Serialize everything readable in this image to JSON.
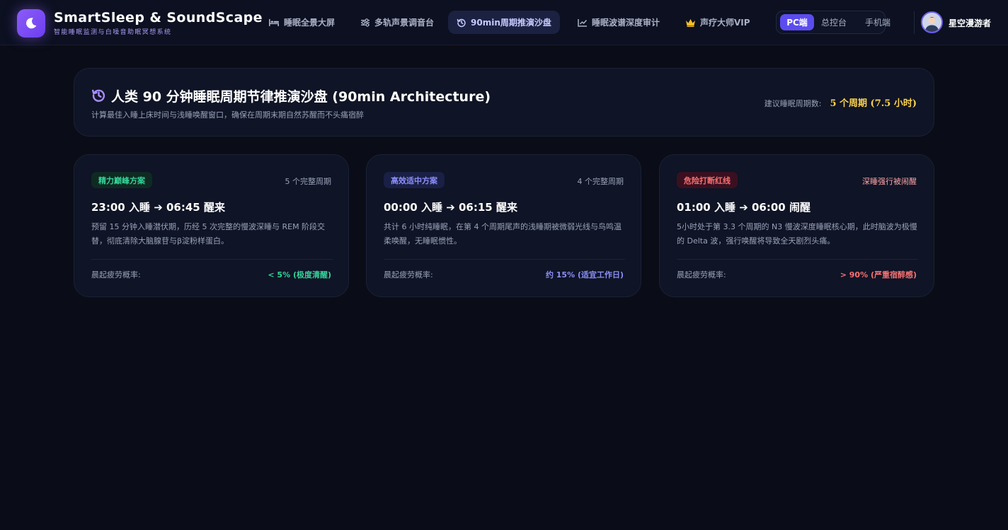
{
  "brand": {
    "title": "SmartSleep & SoundScape",
    "subtitle": "智能睡眠监测与白噪音助眠冥想系统",
    "logo_icon": "moon-icon",
    "accent": "#8b5cf6"
  },
  "nav": [
    {
      "label": "睡眠全景大屏",
      "icon": "bed-icon"
    },
    {
      "label": "多轨声景调音台",
      "icon": "sliders-icon"
    },
    {
      "label": "90min周期推演沙盘",
      "icon": "history-icon",
      "active": true
    },
    {
      "label": "睡眠波谱深度审计",
      "icon": "chart-line-icon"
    },
    {
      "label": "声疗大师VIP",
      "icon": "crown-icon"
    }
  ],
  "view_switch": {
    "options": [
      "PC端",
      "总控台",
      "手机端"
    ],
    "selected": "PC端"
  },
  "user": {
    "name": "星空漫游者",
    "avatar_icon": "avatar"
  },
  "hero": {
    "title": "人类 90 分钟睡眠周期节律推演沙盘 (90min Architecture)",
    "subtitle": "计算最佳入睡上床时间与浅睡唤醒窗口，确保在周期末期自然苏醒而不头痛宿醉",
    "right_label": "建议睡眠周期数:",
    "right_value": "5 个周期 (7.5 小时)",
    "highlight_color": "#fcd34d"
  },
  "plans": [
    {
      "badge": "精力巅峰方案",
      "cycles": "5 个完整周期",
      "title": "23:00 入睡 ➔ 06:45 醒来",
      "desc": "预留 15 分钟入睡潜伏期，历经 5 次完整的慢波深睡与 REM 阶段交替，彻底清除大脑腺苷与β淀粉样蛋白。",
      "rate_label": "晨起疲劳概率:",
      "rate_value": "< 5% (极度清醒)",
      "color": "#34d399"
    },
    {
      "badge": "高效适中方案",
      "cycles": "4 个完整周期",
      "title": "00:00 入睡 ➔ 06:15 醒来",
      "desc": "共计 6 小时纯睡眠，在第 4 个周期尾声的浅睡期被微弱光线与鸟鸣温柔唤醒，无睡眠惯性。",
      "rate_label": "晨起疲劳概率:",
      "rate_value": "约 15% (适宜工作日)",
      "color": "#8b8ff8"
    },
    {
      "badge": "危险打断红线",
      "cycles": "深睡强行被闹醒",
      "title": "01:00 入睡 ➔ 06:00 闹醒",
      "desc": "5小时处于第 3.3 个周期的 N3 慢波深度睡眠核心期，此时脑波为极慢的 Delta 波，强行唤醒将导致全天剧烈头痛。",
      "rate_label": "晨起疲劳概率:",
      "rate_value": "> 90% (严重宿醉感)",
      "color": "#f87171"
    }
  ]
}
